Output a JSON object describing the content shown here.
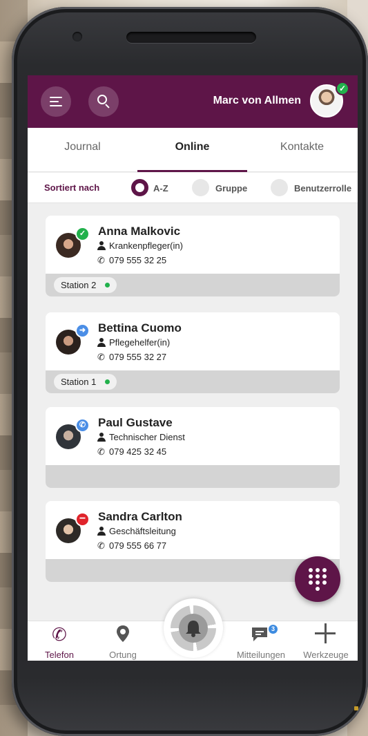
{
  "header": {
    "user_name": "Marc von Allmen",
    "user_status": "online",
    "brand_color": "#5e1548"
  },
  "tabs": [
    {
      "label": "Journal",
      "active": false
    },
    {
      "label": "Online",
      "active": true
    },
    {
      "label": "Kontakte",
      "active": false
    }
  ],
  "sort": {
    "label": "Sortiert nach",
    "options": [
      {
        "label": "A-Z",
        "selected": true
      },
      {
        "label": "Gruppe",
        "selected": false
      },
      {
        "label": "Benutzerrolle",
        "selected": false
      }
    ]
  },
  "contacts": [
    {
      "name": "Anna Malkovic",
      "role": "Krankenpfleger(in)",
      "phone": "079 555 32 25",
      "status": "available",
      "status_icon": "check-icon",
      "status_color": "#22b14c",
      "station": "Station 2"
    },
    {
      "name": "Bettina Cuomo",
      "role": "Pflegehelfer(in)",
      "phone": "079 555 32 27",
      "status": "forwarded",
      "status_icon": "arrow-right-icon",
      "status_color": "#4b8ee6",
      "station": "Station 1"
    },
    {
      "name": "Paul Gustave",
      "role": "Technischer Dienst",
      "phone": "079 425 32 45",
      "status": "on-call",
      "status_icon": "phone-icon",
      "status_color": "#4b8ee6",
      "station": ""
    },
    {
      "name": "Sandra Carlton",
      "role": "Geschäftsleitung",
      "phone": "079 555 66 77",
      "status": "do-not-disturb",
      "status_icon": "minus-icon",
      "status_color": "#e0242b",
      "station": ""
    }
  ],
  "bottom_nav": {
    "telefon": "Telefon",
    "ortung": "Ortung",
    "mitteilungen": "Mitteilungen",
    "mitteilungen_badge": "3",
    "werkzeuge": "Werkzeuge"
  },
  "icons": {
    "phone_glyph": "📞"
  }
}
